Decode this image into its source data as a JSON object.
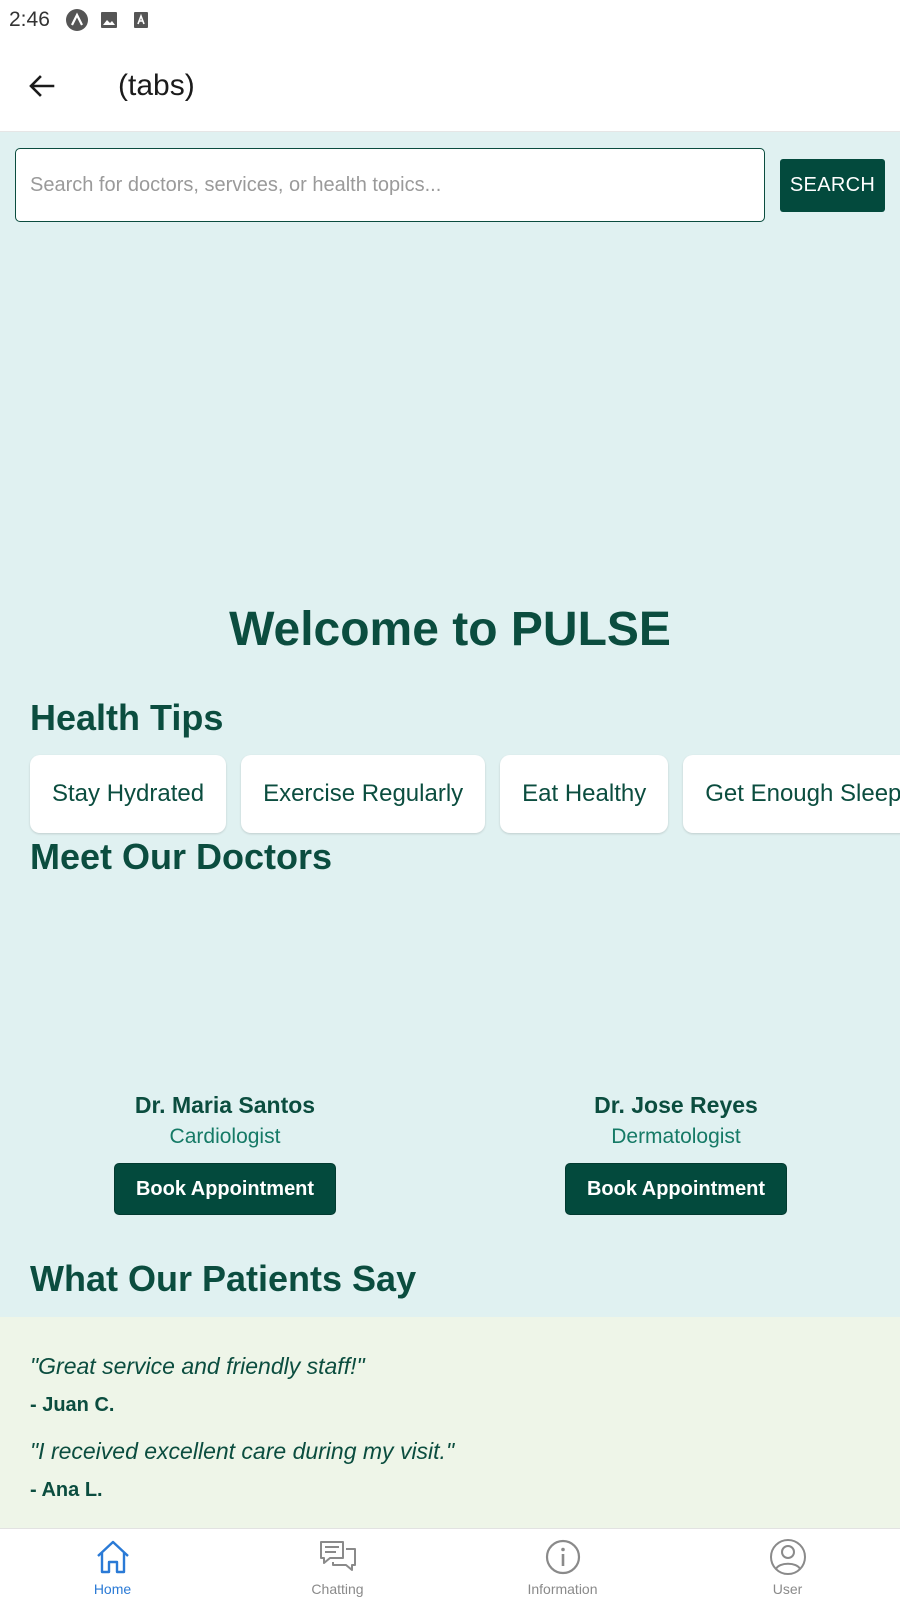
{
  "status_bar": {
    "time": "2:46",
    "icons": [
      "app-notification-icon",
      "image-icon",
      "font-icon"
    ]
  },
  "app_bar": {
    "title": "(tabs)",
    "back_icon": "arrow-left-icon"
  },
  "search": {
    "placeholder": "Search for doctors, services, or health topics...",
    "value": "",
    "button_label": "SEARCH"
  },
  "welcome": "Welcome to PULSE",
  "health_tips": {
    "title": "Health Tips",
    "items": [
      "Stay Hydrated",
      "Exercise Regularly",
      "Eat Healthy",
      "Get Enough Sleep"
    ]
  },
  "doctors": {
    "title": "Meet Our Doctors",
    "items": [
      {
        "name": "Dr. Maria Santos",
        "specialty": "Cardiologist",
        "button": "Book Appointment"
      },
      {
        "name": "Dr. Jose Reyes",
        "specialty": "Dermatologist",
        "button": "Book Appointment"
      }
    ]
  },
  "patients": {
    "title": "What Our Patients Say",
    "items": [
      {
        "quote": "\"Great service and friendly staff!\"",
        "author": "- Juan C."
      },
      {
        "quote": "\"I received excellent care during my visit.\"",
        "author": "- Ana L."
      }
    ]
  },
  "tabs": [
    {
      "label": "Home",
      "icon": "home-icon",
      "active": true
    },
    {
      "label": "Chatting",
      "icon": "chat-icon",
      "active": false
    },
    {
      "label": "Information",
      "icon": "info-icon",
      "active": false
    },
    {
      "label": "User",
      "icon": "user-icon",
      "active": false
    }
  ],
  "colors": {
    "primary": "#034a3d",
    "heading": "#0b4d3f",
    "content_bg": "#e0f1f1",
    "testimonial_bg": "#eef5e8",
    "active_tab": "#2a7ad6"
  }
}
